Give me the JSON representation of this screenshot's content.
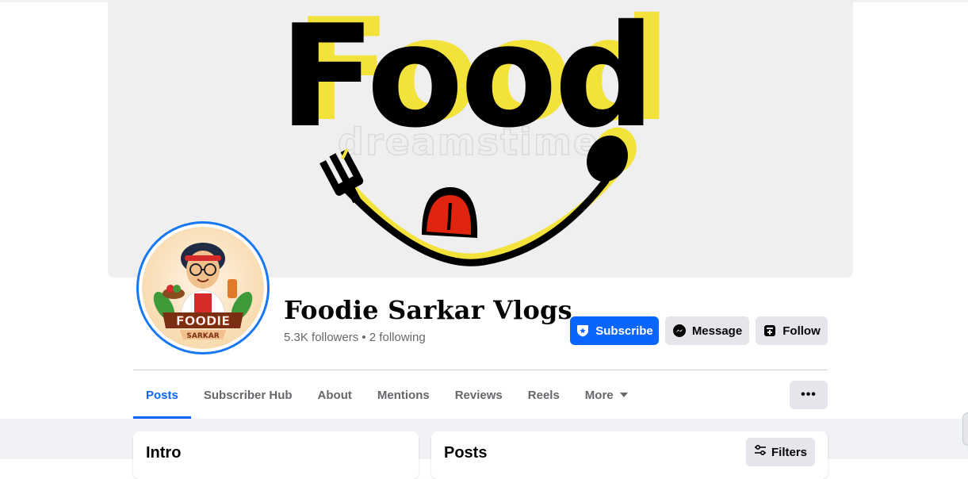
{
  "cover": {
    "logo_text": "Food",
    "watermark": "dreamstime."
  },
  "avatar": {
    "brand_line1": "FOODIE",
    "brand_line2": "SARKAR"
  },
  "profile": {
    "name": "Foodie Sarkar Vlogs",
    "stats": "5.3K followers • 2 following"
  },
  "actions": {
    "subscribe": "Subscribe",
    "message": "Message",
    "follow": "Follow"
  },
  "tabs": [
    {
      "label": "Posts"
    },
    {
      "label": "Subscriber Hub"
    },
    {
      "label": "About"
    },
    {
      "label": "Mentions"
    },
    {
      "label": "Reviews"
    },
    {
      "label": "Reels"
    },
    {
      "label": "More"
    }
  ],
  "more_button": "•••",
  "intro_card": {
    "title": "Intro"
  },
  "posts_card": {
    "title": "Posts",
    "filters_label": "Filters"
  },
  "colors": {
    "accent": "#0866ff",
    "ring": "#1877f2",
    "logo_yellow": "#f2e23a",
    "tongue_red": "#e0240f"
  }
}
